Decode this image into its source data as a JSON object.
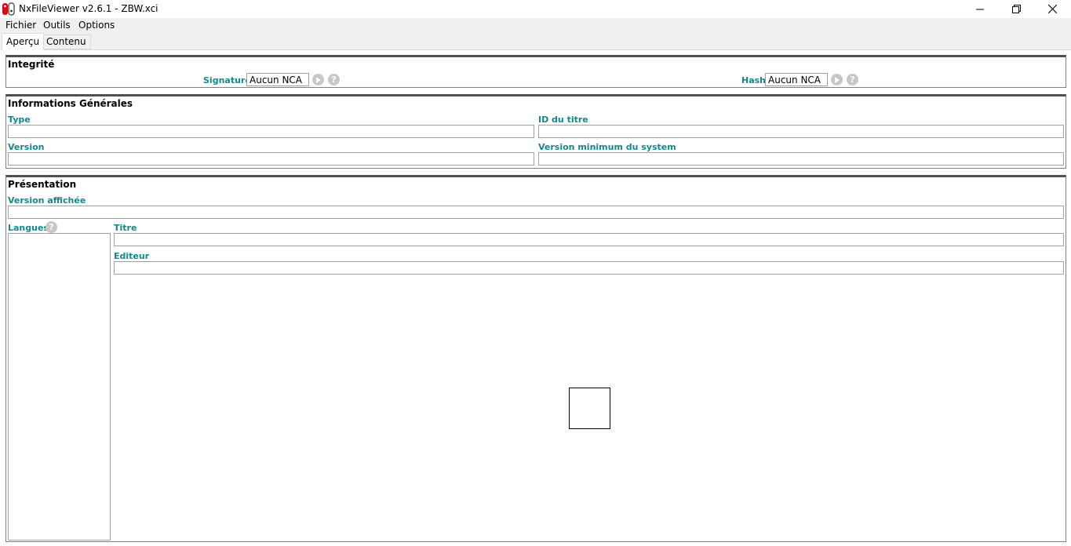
{
  "window": {
    "title": "NxFileViewer v2.6.1 - ZBW.xci",
    "minimize_icon": "minimize-icon",
    "maximize_icon": "restore-icon",
    "close_icon": "close-icon"
  },
  "menu": {
    "items": [
      {
        "label": "Fichier"
      },
      {
        "label": "Outils"
      },
      {
        "label": "Options"
      }
    ]
  },
  "tabs": [
    {
      "label": "Aperçu",
      "active": true
    },
    {
      "label": "Contenu",
      "active": false
    }
  ],
  "integrity": {
    "title": "Integrité",
    "signature_label": "Signature:",
    "signature_value": "Aucun NCA",
    "hash_label": "Hash:",
    "hash_value": "Aucun NCA",
    "help_glyph": "?"
  },
  "general": {
    "title": "Informations Générales",
    "type_label": "Type",
    "type_value": "",
    "title_id_label": "ID du titre",
    "title_id_value": "",
    "version_label": "Version",
    "version_value": "",
    "min_sys_label": "Version minimum du system",
    "min_sys_value": ""
  },
  "presentation": {
    "title": "Présentation",
    "display_version_label": "Version affichée",
    "display_version_value": "",
    "languages_label": "Langues",
    "titre_label": "Titre",
    "titre_value": "",
    "editeur_label": "Editeur",
    "editeur_value": "",
    "help_glyph": "?"
  },
  "colors": {
    "label_accent": "#13878a",
    "play_button": "#c7c7c7"
  }
}
